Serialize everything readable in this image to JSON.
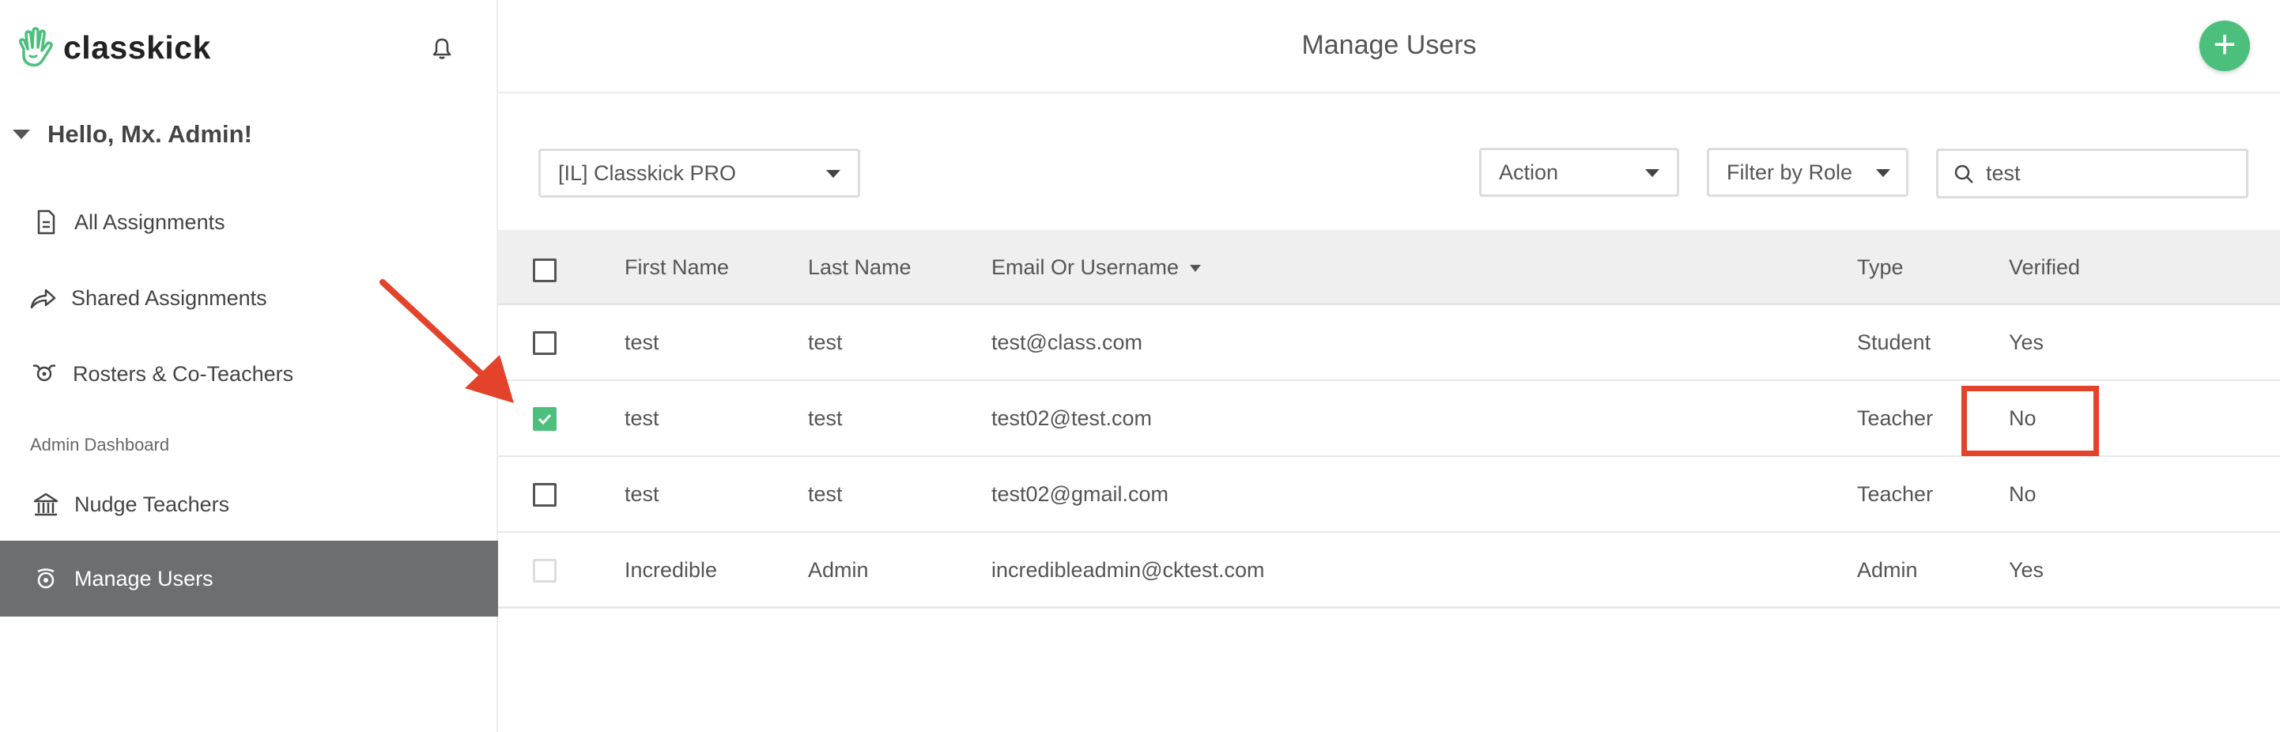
{
  "app": {
    "name": "classkick",
    "accent": "#4cbf7d"
  },
  "sidebar": {
    "greeting": "Hello, Mx. Admin!",
    "items": [
      {
        "label": "All Assignments",
        "icon": "document-icon"
      },
      {
        "label": "Shared Assignments",
        "icon": "share-arrow-icon"
      },
      {
        "label": "Rosters & Co-Teachers",
        "icon": "roster-icon"
      }
    ],
    "section_label": "Admin Dashboard",
    "admin_items": [
      {
        "label": "Nudge Teachers",
        "icon": "building-icon"
      },
      {
        "label": "Manage Users",
        "icon": "users-icon",
        "active": true
      }
    ]
  },
  "header": {
    "title": "Manage Users"
  },
  "toolbar": {
    "organization": "[IL] Classkick PRO",
    "action": "Action",
    "filter": "Filter by Role",
    "search_value": "test"
  },
  "table": {
    "columns": [
      "First Name",
      "Last Name",
      "Email Or Username",
      "Type",
      "Verified"
    ],
    "rows": [
      {
        "first": "test",
        "last": "test",
        "email": "test@class.com",
        "type": "Student",
        "verified": "Yes",
        "checked": false
      },
      {
        "first": "test",
        "last": "test",
        "email": "test02@test.com",
        "type": "Teacher",
        "verified": "No",
        "checked": true
      },
      {
        "first": "test",
        "last": "test",
        "email": "test02@gmail.com",
        "type": "Teacher",
        "verified": "No",
        "checked": false
      },
      {
        "first": "Incredible",
        "last": "Admin",
        "email": "incredibleadmin@cktest.com",
        "type": "Admin",
        "verified": "Yes",
        "checked": false,
        "disabled": true
      }
    ]
  },
  "annotation_color": "#e2432a"
}
